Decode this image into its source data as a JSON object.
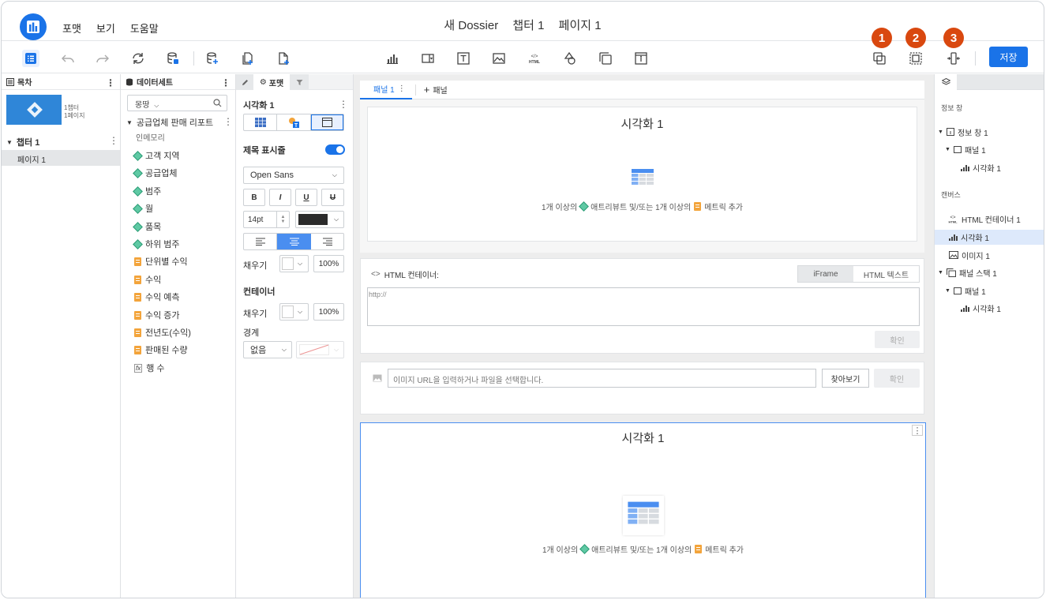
{
  "app": {
    "menu": [
      "포맷",
      "보기",
      "도움말"
    ],
    "title_parts": [
      "새 Dossier",
      "챕터 1",
      "페이지 1"
    ]
  },
  "toolbar": {
    "save_label": "저장",
    "badges": [
      "1",
      "2",
      "3"
    ]
  },
  "toc": {
    "header": "목차",
    "thumb_text": [
      "1챕터",
      "1페이지"
    ],
    "chapter": "챕터 1",
    "page": "페이지 1"
  },
  "dataset": {
    "header": "데이터세트",
    "search_placeholder": "몽땅",
    "report": "공급업체 판매 리포트",
    "in_memory": "인메모리",
    "attributes": [
      "고객 지역",
      "공급업체",
      "범주",
      "월",
      "품목",
      "하위 범주"
    ],
    "metrics": [
      "단위별 수익",
      "수익",
      "수익 예측",
      "수익 증가",
      "전년도(수익)",
      "판매된 수량"
    ],
    "derived": "행 수"
  },
  "format": {
    "tab_label": "포맷",
    "viz_name": "시각화 1",
    "title_bar_label": "제목 표시줄",
    "font": "Open Sans",
    "font_size": "14pt",
    "fill_label": "채우기",
    "fill_opacity": "100%",
    "container_label": "컨테이너",
    "container_fill_label": "채우기",
    "container_fill_opacity": "100%",
    "border_label": "경계",
    "border_value": "없음",
    "bold": "B",
    "italic": "I",
    "underline": "U",
    "strike": "U"
  },
  "canvas": {
    "panel_tab": "패널 1",
    "add_panel": "패널",
    "viz_title_1": "시각화 1",
    "viz_title_2": "시각화 1",
    "hint_pre": "1개 이상의",
    "hint_attr": "애트리뷰트 및/또는 1개 이상의",
    "hint_metric": "메트릭 추가",
    "html_label": "HTML 컨테이너:",
    "iframe_label": "iFrame",
    "html_text_label": "HTML 텍스트",
    "url_placeholder": "http://",
    "confirm_label": "확인",
    "image_placeholder": "이미지 URL을 입력하거나 파일을 선택합니다.",
    "browse_label": "찾아보기",
    "image_confirm_label": "확인"
  },
  "layers": {
    "info_section": "정보 창",
    "info_window": "정보 창 1",
    "info_panel": "패널 1",
    "info_viz": "시각화 1",
    "canvas_section": "캔버스",
    "html_container": "HTML 컨테이너 1",
    "viz": "시각화 1",
    "image": "이미지 1",
    "panel_stack": "패널 스택 1",
    "stack_panel": "패널 1",
    "stack_viz": "시각화 1"
  },
  "colors": {
    "accent": "#1a73e8",
    "badge": "#d9480f",
    "attribute": "#5fc9a4",
    "metric": "#f3a43b"
  }
}
